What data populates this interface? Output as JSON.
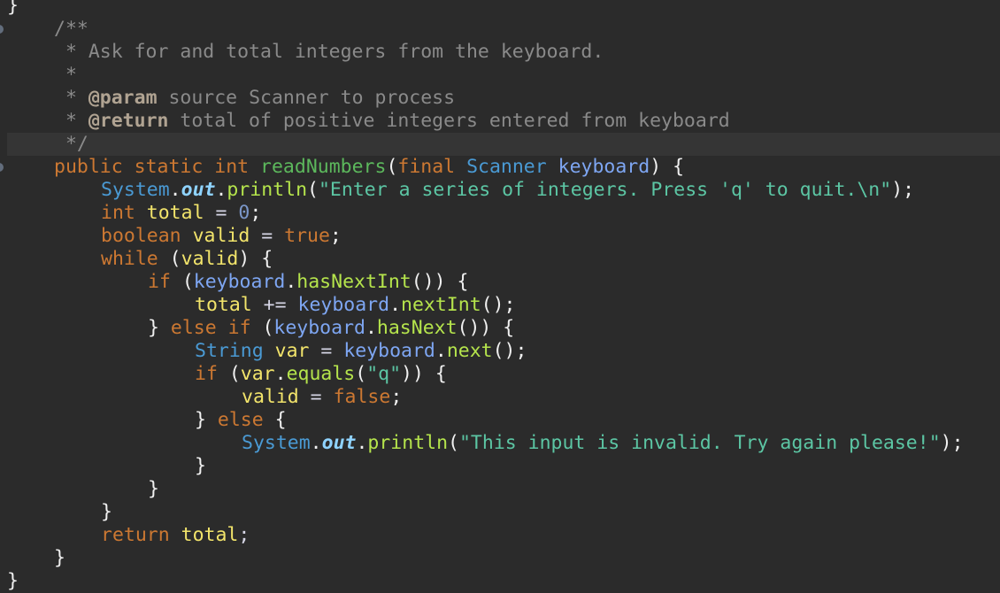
{
  "editor": {
    "language": "java",
    "current_line_index": 6,
    "lines": [
      {
        "indent": 0,
        "tokens": [
          {
            "t": "}",
            "k": "punct"
          }
        ]
      },
      {
        "indent": 1,
        "tokens": [
          {
            "t": "/**",
            "k": "comment"
          }
        ]
      },
      {
        "indent": 1,
        "tokens": [
          {
            "t": " * Ask for and total integers from the keyboard.",
            "k": "comment"
          }
        ]
      },
      {
        "indent": 1,
        "tokens": [
          {
            "t": " *",
            "k": "comment"
          }
        ]
      },
      {
        "indent": 1,
        "tokens": [
          {
            "t": " * ",
            "k": "comment"
          },
          {
            "t": "@param",
            "k": "tag"
          },
          {
            "t": " source Scanner to process",
            "k": "comment"
          }
        ]
      },
      {
        "indent": 1,
        "tokens": [
          {
            "t": " * ",
            "k": "comment"
          },
          {
            "t": "@return",
            "k": "tag"
          },
          {
            "t": " total of positive integers entered from keyboard",
            "k": "comment"
          }
        ]
      },
      {
        "indent": 1,
        "tokens": [
          {
            "t": " */",
            "k": "comment"
          }
        ]
      },
      {
        "indent": 1,
        "tokens": [
          {
            "t": "public",
            "k": "kw"
          },
          {
            "t": " ",
            "k": "punct"
          },
          {
            "t": "static",
            "k": "kw"
          },
          {
            "t": " ",
            "k": "punct"
          },
          {
            "t": "int",
            "k": "kw"
          },
          {
            "t": " ",
            "k": "punct"
          },
          {
            "t": "readNumbers",
            "k": "method-decl"
          },
          {
            "t": "(",
            "k": "punct"
          },
          {
            "t": "final",
            "k": "kw"
          },
          {
            "t": " ",
            "k": "punct"
          },
          {
            "t": "Scanner",
            "k": "type"
          },
          {
            "t": " ",
            "k": "punct"
          },
          {
            "t": "keyboard",
            "k": "param"
          },
          {
            "t": ") {",
            "k": "punct"
          }
        ]
      },
      {
        "indent": 2,
        "tokens": [
          {
            "t": "System",
            "k": "type"
          },
          {
            "t": ".",
            "k": "punct"
          },
          {
            "t": "out",
            "k": "static-field"
          },
          {
            "t": ".",
            "k": "punct"
          },
          {
            "t": "println",
            "k": "method"
          },
          {
            "t": "(",
            "k": "punct"
          },
          {
            "t": "\"Enter a series of integers. Press 'q' to quit.\\n\"",
            "k": "string"
          },
          {
            "t": ");",
            "k": "punct"
          }
        ]
      },
      {
        "indent": 2,
        "tokens": [
          {
            "t": "int",
            "k": "kw"
          },
          {
            "t": " ",
            "k": "punct"
          },
          {
            "t": "total",
            "k": "local"
          },
          {
            "t": " = ",
            "k": "op"
          },
          {
            "t": "0",
            "k": "number"
          },
          {
            "t": ";",
            "k": "punct"
          }
        ]
      },
      {
        "indent": 2,
        "tokens": [
          {
            "t": "boolean",
            "k": "kw"
          },
          {
            "t": " ",
            "k": "punct"
          },
          {
            "t": "valid",
            "k": "local"
          },
          {
            "t": " = ",
            "k": "op"
          },
          {
            "t": "true",
            "k": "kw"
          },
          {
            "t": ";",
            "k": "punct"
          }
        ]
      },
      {
        "indent": 2,
        "tokens": [
          {
            "t": "while",
            "k": "kw"
          },
          {
            "t": " (",
            "k": "punct"
          },
          {
            "t": "valid",
            "k": "local"
          },
          {
            "t": ") {",
            "k": "punct"
          }
        ]
      },
      {
        "indent": 3,
        "tokens": [
          {
            "t": "if",
            "k": "kw"
          },
          {
            "t": " (",
            "k": "punct"
          },
          {
            "t": "keyboard",
            "k": "param"
          },
          {
            "t": ".",
            "k": "punct"
          },
          {
            "t": "hasNextInt",
            "k": "method"
          },
          {
            "t": "()) {",
            "k": "punct"
          }
        ]
      },
      {
        "indent": 4,
        "tokens": [
          {
            "t": "total",
            "k": "local"
          },
          {
            "t": " += ",
            "k": "op"
          },
          {
            "t": "keyboard",
            "k": "param"
          },
          {
            "t": ".",
            "k": "punct"
          },
          {
            "t": "nextInt",
            "k": "method"
          },
          {
            "t": "();",
            "k": "punct"
          }
        ]
      },
      {
        "indent": 3,
        "tokens": [
          {
            "t": "} ",
            "k": "punct"
          },
          {
            "t": "else",
            "k": "kw"
          },
          {
            "t": " ",
            "k": "punct"
          },
          {
            "t": "if",
            "k": "kw"
          },
          {
            "t": " (",
            "k": "punct"
          },
          {
            "t": "keyboard",
            "k": "param"
          },
          {
            "t": ".",
            "k": "punct"
          },
          {
            "t": "hasNext",
            "k": "method"
          },
          {
            "t": "()) {",
            "k": "punct"
          }
        ]
      },
      {
        "indent": 4,
        "tokens": [
          {
            "t": "String",
            "k": "type"
          },
          {
            "t": " ",
            "k": "punct"
          },
          {
            "t": "var",
            "k": "local"
          },
          {
            "t": " = ",
            "k": "op"
          },
          {
            "t": "keyboard",
            "k": "param"
          },
          {
            "t": ".",
            "k": "punct"
          },
          {
            "t": "next",
            "k": "method"
          },
          {
            "t": "();",
            "k": "punct"
          }
        ]
      },
      {
        "indent": 4,
        "tokens": [
          {
            "t": "if",
            "k": "kw"
          },
          {
            "t": " (",
            "k": "punct"
          },
          {
            "t": "var",
            "k": "local"
          },
          {
            "t": ".",
            "k": "punct"
          },
          {
            "t": "equals",
            "k": "method"
          },
          {
            "t": "(",
            "k": "punct"
          },
          {
            "t": "\"q\"",
            "k": "string"
          },
          {
            "t": ")) {",
            "k": "punct"
          }
        ]
      },
      {
        "indent": 5,
        "tokens": [
          {
            "t": "valid",
            "k": "local"
          },
          {
            "t": " = ",
            "k": "op"
          },
          {
            "t": "false",
            "k": "kw"
          },
          {
            "t": ";",
            "k": "punct"
          }
        ]
      },
      {
        "indent": 4,
        "tokens": [
          {
            "t": "} ",
            "k": "punct"
          },
          {
            "t": "else",
            "k": "kw"
          },
          {
            "t": " {",
            "k": "punct"
          }
        ]
      },
      {
        "indent": 5,
        "tokens": [
          {
            "t": "System",
            "k": "type"
          },
          {
            "t": ".",
            "k": "punct"
          },
          {
            "t": "out",
            "k": "static-field"
          },
          {
            "t": ".",
            "k": "punct"
          },
          {
            "t": "println",
            "k": "method"
          },
          {
            "t": "(",
            "k": "punct"
          },
          {
            "t": "\"This input is invalid. Try again please!\"",
            "k": "string"
          },
          {
            "t": ");",
            "k": "punct"
          }
        ]
      },
      {
        "indent": 4,
        "tokens": [
          {
            "t": "}",
            "k": "punct"
          }
        ]
      },
      {
        "indent": 3,
        "tokens": [
          {
            "t": "}",
            "k": "punct"
          }
        ]
      },
      {
        "indent": 2,
        "tokens": [
          {
            "t": "}",
            "k": "punct"
          }
        ]
      },
      {
        "indent": 2,
        "tokens": [
          {
            "t": "return",
            "k": "kw"
          },
          {
            "t": " ",
            "k": "punct"
          },
          {
            "t": "total",
            "k": "local"
          },
          {
            "t": ";",
            "k": "op"
          }
        ]
      },
      {
        "indent": 1,
        "tokens": [
          {
            "t": "}",
            "k": "punct"
          }
        ]
      },
      {
        "indent": 0,
        "tokens": [
          {
            "t": "}",
            "k": "punct"
          }
        ]
      }
    ],
    "gutter_markers": [
      1,
      7
    ]
  }
}
